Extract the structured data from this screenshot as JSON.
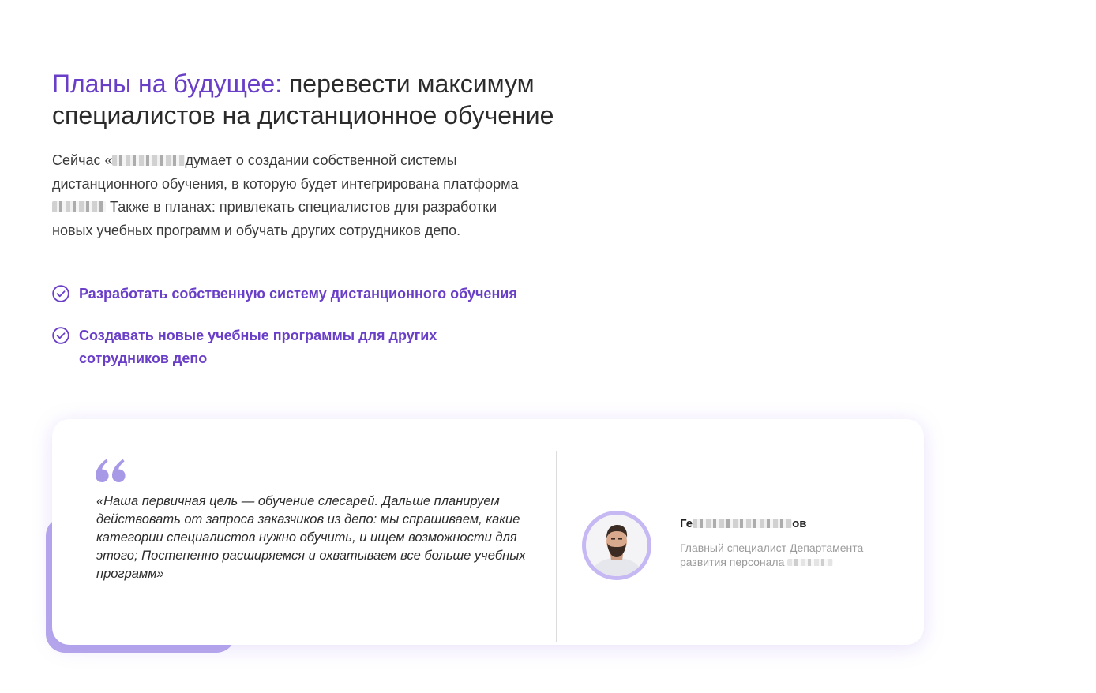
{
  "section": {
    "title_accent": "Планы на будущее:",
    "title_rest": " перевести максимум специалистов на дистанционное обучение",
    "intro_part1": "Сейчас «",
    "intro_part2": "думает о создании собственной системы дистанционного обучения, в которую будет интегрирована платформа ",
    "intro_part3": " Также в планах: привлекать специалистов для разработки новых учебных программ и обучать других сотрудников депо."
  },
  "benefits": [
    {
      "text": "Разработать собственную систему дистанционного обучения",
      "icon": "check-circle-icon"
    },
    {
      "text": "Создавать новые учебные программы для других сотрудников депо",
      "icon": "check-circle-icon"
    }
  ],
  "testimonial": {
    "quote_icon": "quote-icon",
    "quote": "«Наша первичная цель — обучение слесарей. Дальше планируем действовать от запроса заказчиков из депо: мы спрашиваем, какие категории специалистов нужно обучить, и ищем возможности для этого; Постепенно расширяемся и охватываем все больше учебных программ»",
    "author_name_start": "Ге",
    "author_name_end": "ов",
    "author_role": "Главный специалист Департамента развития персонала "
  },
  "colors": {
    "accent": "#6a3fc8",
    "accent_light": "#b6a8ec",
    "text": "#2b2b2b",
    "muted": "#9a9a9a"
  }
}
